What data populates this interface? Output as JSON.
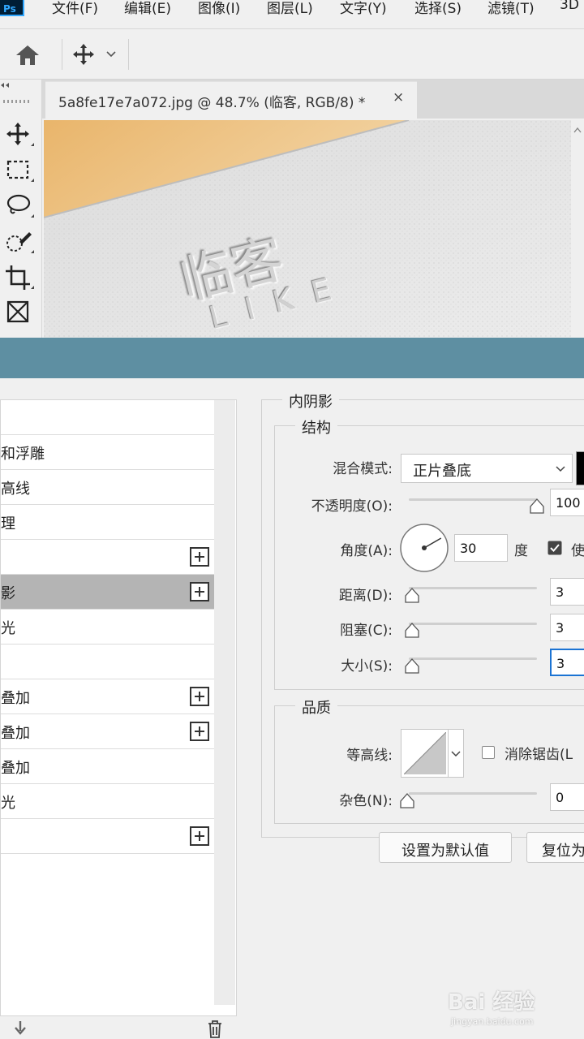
{
  "app": {
    "logo": "Ps"
  },
  "menu": [
    "文件(F)",
    "编辑(E)",
    "图像(I)",
    "图层(L)",
    "文字(Y)",
    "选择(S)",
    "滤镜(T)",
    "3D"
  ],
  "document_tab": {
    "title": "5a8fe17e7a072.jpg @ 48.7% (临客, RGB/8) *",
    "close": "×"
  },
  "canvas_text": {
    "main": "临客",
    "sub": "L I K E"
  },
  "style_list": [
    {
      "label": "",
      "plus": false,
      "selected": false
    },
    {
      "label": "和浮雕",
      "plus": false,
      "selected": false
    },
    {
      "label": "高线",
      "plus": false,
      "selected": false
    },
    {
      "label": "理",
      "plus": false,
      "selected": false
    },
    {
      "label": "",
      "plus": true,
      "selected": false
    },
    {
      "label": "影",
      "plus": true,
      "selected": true
    },
    {
      "label": "光",
      "plus": false,
      "selected": false
    },
    {
      "label": "",
      "plus": false,
      "selected": false
    },
    {
      "label": "叠加",
      "plus": true,
      "selected": false
    },
    {
      "label": "叠加",
      "plus": true,
      "selected": false
    },
    {
      "label": "叠加",
      "plus": false,
      "selected": false
    },
    {
      "label": "光",
      "plus": false,
      "selected": false
    },
    {
      "label": "",
      "plus": true,
      "selected": false
    }
  ],
  "panel": {
    "title": "内阴影",
    "structure": {
      "title": "结构",
      "blend_mode_label": "混合模式:",
      "blend_mode_value": "正片叠底",
      "blend_color": "#000000",
      "opacity_label": "不透明度(O):",
      "opacity_value": "100",
      "opacity_level": 1.0,
      "angle_label": "角度(A):",
      "angle_value": "30",
      "angle_unit": "度",
      "global_light_label": "使",
      "global_light_checked": true,
      "distance_label": "距离(D):",
      "distance_value": "3",
      "choke_label": "阻塞(C):",
      "choke_value": "3",
      "size_label": "大小(S):",
      "size_value": "3"
    },
    "quality": {
      "title": "品质",
      "contour_label": "等高线:",
      "antialias_label": "消除锯齿(L",
      "antialias_checked": false,
      "noise_label": "杂色(N):",
      "noise_value": "0"
    },
    "buttons": {
      "default": "设置为默认值",
      "reset": "复位为"
    }
  },
  "watermark": {
    "main": "Bai 经验",
    "url": "jingyan.baidu.com"
  }
}
